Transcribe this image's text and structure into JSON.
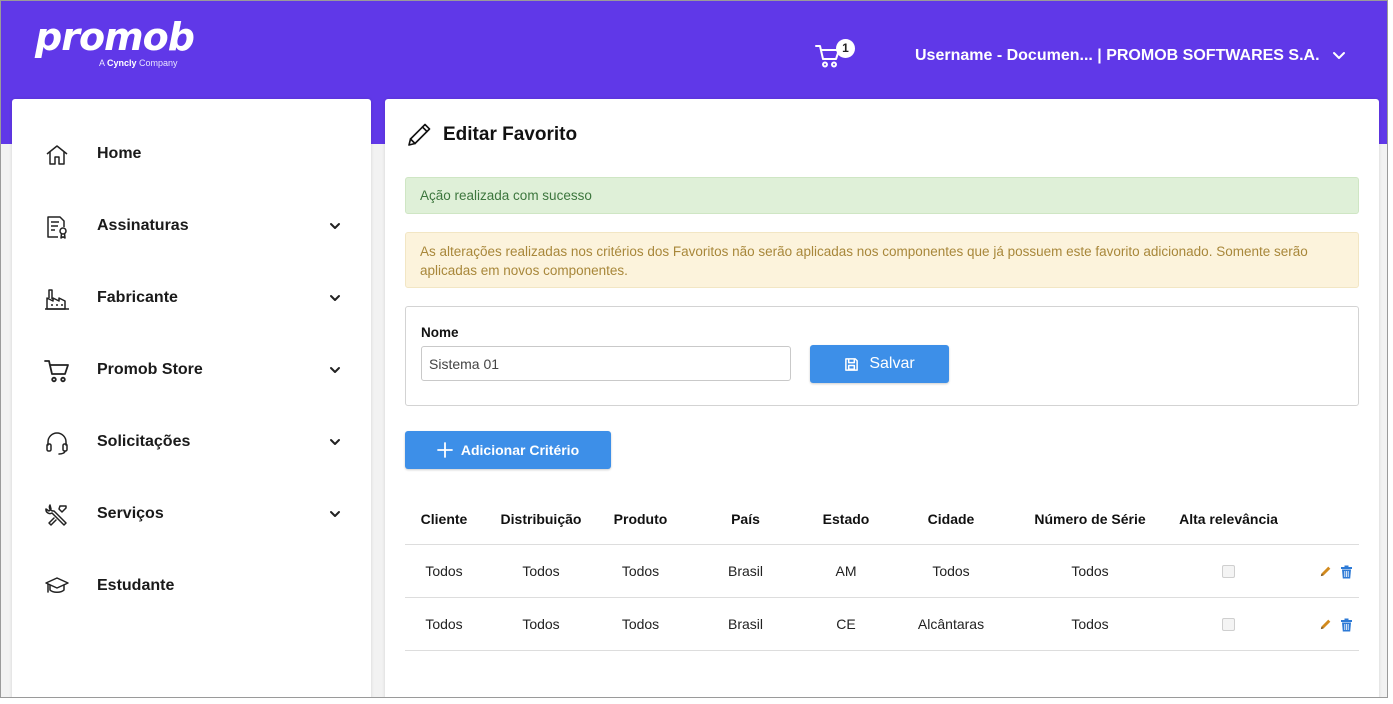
{
  "brand": {
    "logo_word": "promob",
    "tagline_prefix": "A ",
    "tagline_brand": "Cyncly",
    "tagline_suffix": " Company"
  },
  "header": {
    "cart_count": "1",
    "user_label": "Username - Documen... | PROMOB SOFTWARES S.A."
  },
  "sidebar": {
    "items": [
      {
        "label": "Home",
        "icon": "home-icon",
        "expandable": false
      },
      {
        "label": "Assinaturas",
        "icon": "certificate-icon",
        "expandable": true
      },
      {
        "label": "Fabricante",
        "icon": "factory-icon",
        "expandable": true
      },
      {
        "label": "Promob Store",
        "icon": "cart-icon",
        "expandable": true
      },
      {
        "label": "Solicitações",
        "icon": "headset-icon",
        "expandable": true
      },
      {
        "label": "Serviços",
        "icon": "tools-icon",
        "expandable": true
      },
      {
        "label": "Estudante",
        "icon": "graduation-cap-icon",
        "expandable": false
      }
    ]
  },
  "main": {
    "title": "Editar Favorito",
    "success_message": "Ação realizada com sucesso",
    "warning_message": "As alterações realizadas nos critérios dos Favoritos não serão aplicadas nos componentes que já possuem este favorito adicionado. Somente serão aplicadas em novos componentes.",
    "form": {
      "name_label": "Nome",
      "name_value": "Sistema 01",
      "save_label": "Salvar"
    },
    "add_criteria_label": "Adicionar Critério",
    "table": {
      "headers": [
        "Cliente",
        "Distribuição",
        "Produto",
        "País",
        "Estado",
        "Cidade",
        "Número de Série",
        "Alta relevância"
      ],
      "rows": [
        {
          "cliente": "Todos",
          "distribuicao": "Todos",
          "produto": "Todos",
          "pais": "Brasil",
          "estado": "AM",
          "cidade": "Todos",
          "numero_serie": "Todos",
          "alta_relevancia": false
        },
        {
          "cliente": "Todos",
          "distribuicao": "Todos",
          "produto": "Todos",
          "pais": "Brasil",
          "estado": "CE",
          "cidade": "Alcântaras",
          "numero_serie": "Todos",
          "alta_relevancia": false
        }
      ]
    }
  },
  "colors": {
    "brand_purple": "#6038e8",
    "primary_button": "#3d8fe8",
    "success_bg": "#dff0d8",
    "warning_bg": "#fcf3dc",
    "edit_icon": "#d28a1e",
    "delete_icon": "#2d7ad6"
  }
}
